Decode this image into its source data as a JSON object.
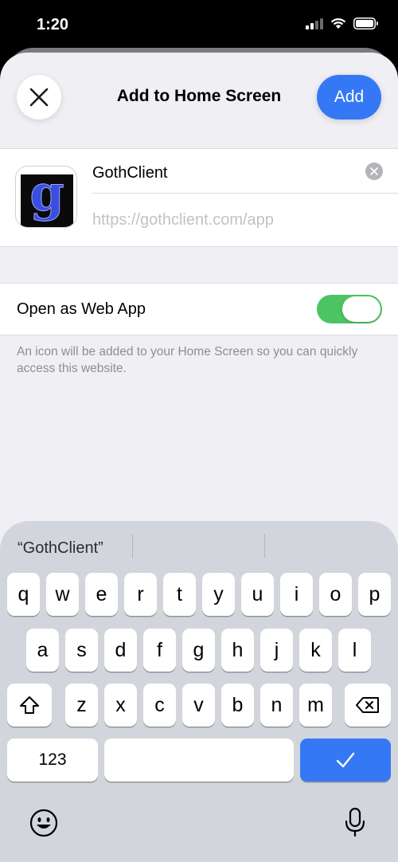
{
  "status_bar": {
    "time": "1:20"
  },
  "sheet": {
    "title": "Add to Home Screen",
    "add_label": "Add",
    "close_icon": "close-icon"
  },
  "app": {
    "name": "GothClient",
    "url": "https://gothclient.com/app",
    "icon_letter": "g",
    "icon_color": "#3a4fe0"
  },
  "settings": {
    "open_as_web_app_label": "Open as Web App",
    "open_as_web_app_on": true,
    "toggle_color": "#4cc463",
    "footnote": "An icon will be added to your Home Screen so you can quickly access this website."
  },
  "keyboard": {
    "suggestion": "“GothClient”",
    "row1": [
      "q",
      "w",
      "e",
      "r",
      "t",
      "y",
      "u",
      "i",
      "o",
      "p"
    ],
    "row2": [
      "a",
      "s",
      "d",
      "f",
      "g",
      "h",
      "j",
      "k",
      "l"
    ],
    "row3": [
      "z",
      "x",
      "c",
      "v",
      "b",
      "n",
      "m"
    ],
    "numbers_label": "123",
    "accent_color": "#3478f6"
  }
}
